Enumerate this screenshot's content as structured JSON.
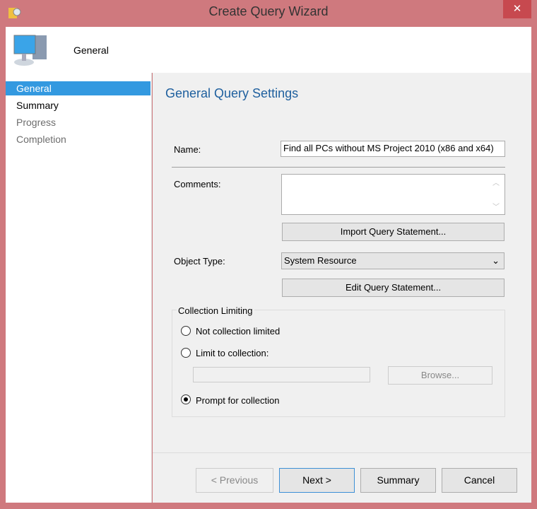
{
  "window": {
    "title": "Create Query Wizard",
    "close": "✕"
  },
  "header": {
    "page": "General"
  },
  "nav": [
    {
      "label": "General",
      "state": "selected"
    },
    {
      "label": "Summary",
      "state": "normal"
    },
    {
      "label": "Progress",
      "state": "disabled"
    },
    {
      "label": "Completion",
      "state": "disabled"
    }
  ],
  "main": {
    "heading": "General Query Settings",
    "name_label": "Name:",
    "name_value": "Find all PCs without  MS Project 2010 (x86 and x64)",
    "comments_label": "Comments:",
    "comments_value": "",
    "import_button": "Import Query Statement...",
    "object_type_label": "Object Type:",
    "object_type_value": "System Resource",
    "edit_button": "Edit Query Statement...",
    "collection_group": "Collection Limiting",
    "radio_not_limited": "Not collection limited",
    "radio_limit": "Limit to collection:",
    "collection_value": "",
    "browse_button": "Browse...",
    "radio_prompt": "Prompt for collection",
    "selected_option": "Prompt for collection"
  },
  "footer": {
    "previous": "< Previous",
    "next": "Next >",
    "summary": "Summary",
    "cancel": "Cancel"
  }
}
